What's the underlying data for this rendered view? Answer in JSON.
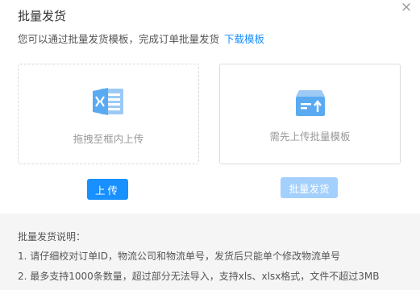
{
  "dialog": {
    "title": "批量发货",
    "close_symbol": "×",
    "description": "您可以通过批量发货模板，完成订单批量发货",
    "download_link": "下载模板"
  },
  "upload_area": {
    "icon": "excel-file-icon",
    "hint": "拖拽至框内上传",
    "button_label": "上传"
  },
  "template_area": {
    "icon": "batch-ship-icon",
    "hint": "需先上传批量模板",
    "button_label": "批量发货"
  },
  "notes": {
    "heading": "批量发货说明：",
    "items": [
      "1. 请仔细校对订单ID，物流公司和物流单号，发货后只能单个修改物流单号",
      "2. 最多支持1000条数量，超过部分无法导入，支持xls、xlsx格式，文件不超过3MB"
    ]
  },
  "colors": {
    "primary": "#1890ff",
    "primary_disabled": "#a3d0fd",
    "icon_blue": "#5aaaf2",
    "icon_light": "#9ccaf5"
  }
}
